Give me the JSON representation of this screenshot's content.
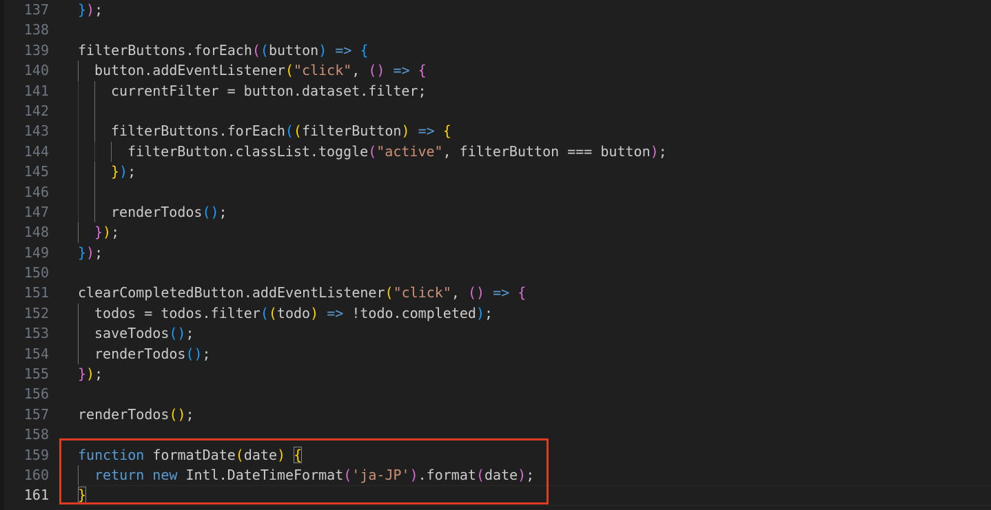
{
  "editor": {
    "language": "javascript",
    "theme": "dark",
    "current_line": 161,
    "lines": [
      {
        "number": 137,
        "indent": 0,
        "tokens": [
          [
            "b3",
            "}"
          ],
          [
            "b2",
            ")"
          ],
          [
            "p",
            ";"
          ]
        ]
      },
      {
        "number": 138,
        "indent": 0,
        "tokens": []
      },
      {
        "number": 139,
        "indent": 0,
        "tokens": [
          [
            "d",
            "filterButtons.forEach"
          ],
          [
            "b2",
            "("
          ],
          [
            "b3",
            "("
          ],
          [
            "d",
            "button"
          ],
          [
            "b3",
            ")"
          ],
          [
            "d",
            " "
          ],
          [
            "k",
            "=>"
          ],
          [
            "d",
            " "
          ],
          [
            "b3",
            "{"
          ]
        ]
      },
      {
        "number": 140,
        "indent": 1,
        "tokens": [
          [
            "d",
            "button.addEventListener"
          ],
          [
            "b1",
            "("
          ],
          [
            "s",
            "\"click\""
          ],
          [
            "p",
            ", "
          ],
          [
            "b2",
            "()"
          ],
          [
            "d",
            " "
          ],
          [
            "k",
            "=>"
          ],
          [
            "d",
            " "
          ],
          [
            "b2",
            "{"
          ]
        ]
      },
      {
        "number": 141,
        "indent": 2,
        "tokens": [
          [
            "d",
            "currentFilter = button.dataset.filter;"
          ]
        ]
      },
      {
        "number": 142,
        "indent": 2,
        "tokens": []
      },
      {
        "number": 143,
        "indent": 2,
        "tokens": [
          [
            "d",
            "filterButtons.forEach"
          ],
          [
            "b3",
            "("
          ],
          [
            "b1",
            "("
          ],
          [
            "d",
            "filterButton"
          ],
          [
            "b1",
            ")"
          ],
          [
            "d",
            " "
          ],
          [
            "k",
            "=>"
          ],
          [
            "d",
            " "
          ],
          [
            "b1",
            "{"
          ]
        ]
      },
      {
        "number": 144,
        "indent": 3,
        "tokens": [
          [
            "d",
            "filterButton.classList.toggle"
          ],
          [
            "b2",
            "("
          ],
          [
            "s",
            "\"active\""
          ],
          [
            "p",
            ", filterButton === button"
          ],
          [
            "b2",
            ")"
          ],
          [
            "p",
            ";"
          ]
        ]
      },
      {
        "number": 145,
        "indent": 2,
        "tokens": [
          [
            "b1",
            "}"
          ],
          [
            "b3",
            ")"
          ],
          [
            "p",
            ";"
          ]
        ]
      },
      {
        "number": 146,
        "indent": 2,
        "tokens": []
      },
      {
        "number": 147,
        "indent": 2,
        "tokens": [
          [
            "d",
            "renderTodos"
          ],
          [
            "b3",
            "()"
          ],
          [
            "p",
            ";"
          ]
        ]
      },
      {
        "number": 148,
        "indent": 1,
        "tokens": [
          [
            "b2",
            "}"
          ],
          [
            "b1",
            ")"
          ],
          [
            "p",
            ";"
          ]
        ]
      },
      {
        "number": 149,
        "indent": 0,
        "tokens": [
          [
            "b3",
            "}"
          ],
          [
            "b2",
            ")"
          ],
          [
            "p",
            ";"
          ]
        ]
      },
      {
        "number": 150,
        "indent": 0,
        "tokens": []
      },
      {
        "number": 151,
        "indent": 0,
        "tokens": [
          [
            "d",
            "clearCompletedButton.addEventListener"
          ],
          [
            "b1",
            "("
          ],
          [
            "s",
            "\"click\""
          ],
          [
            "p",
            ", "
          ],
          [
            "b2",
            "()"
          ],
          [
            "d",
            " "
          ],
          [
            "k",
            "=>"
          ],
          [
            "d",
            " "
          ],
          [
            "b2",
            "{"
          ]
        ]
      },
      {
        "number": 152,
        "indent": 1,
        "tokens": [
          [
            "d",
            "todos = todos.filter"
          ],
          [
            "b3",
            "("
          ],
          [
            "b1",
            "("
          ],
          [
            "d",
            "todo"
          ],
          [
            "b1",
            ")"
          ],
          [
            "d",
            " "
          ],
          [
            "k",
            "=>"
          ],
          [
            "d",
            " !todo.completed"
          ],
          [
            "b3",
            ")"
          ],
          [
            "p",
            ";"
          ]
        ]
      },
      {
        "number": 153,
        "indent": 1,
        "tokens": [
          [
            "d",
            "saveTodos"
          ],
          [
            "b3",
            "()"
          ],
          [
            "p",
            ";"
          ]
        ]
      },
      {
        "number": 154,
        "indent": 1,
        "tokens": [
          [
            "d",
            "renderTodos"
          ],
          [
            "b3",
            "()"
          ],
          [
            "p",
            ";"
          ]
        ]
      },
      {
        "number": 155,
        "indent": 0,
        "tokens": [
          [
            "b2",
            "}"
          ],
          [
            "b1",
            ")"
          ],
          [
            "p",
            ";"
          ]
        ]
      },
      {
        "number": 156,
        "indent": 0,
        "tokens": []
      },
      {
        "number": 157,
        "indent": 0,
        "tokens": [
          [
            "d",
            "renderTodos"
          ],
          [
            "b1",
            "()"
          ],
          [
            "p",
            ";"
          ]
        ]
      },
      {
        "number": 158,
        "indent": 0,
        "tokens": []
      },
      {
        "number": 159,
        "indent": 0,
        "tokens": [
          [
            "k",
            "function"
          ],
          [
            "d",
            " formatDate"
          ],
          [
            "b1",
            "("
          ],
          [
            "d",
            "date"
          ],
          [
            "b1",
            ")"
          ],
          [
            "d",
            " "
          ],
          [
            "b1m",
            "{"
          ]
        ]
      },
      {
        "number": 160,
        "indent": 1,
        "tokens": [
          [
            "k",
            "return"
          ],
          [
            "d",
            " "
          ],
          [
            "k",
            "new"
          ],
          [
            "d",
            " Intl.DateTimeFormat"
          ],
          [
            "b2",
            "("
          ],
          [
            "s",
            "'ja-JP'"
          ],
          [
            "b2",
            ")"
          ],
          [
            "d",
            ".format"
          ],
          [
            "b2",
            "("
          ],
          [
            "d",
            "date"
          ],
          [
            "b2",
            ")"
          ],
          [
            "p",
            ";"
          ]
        ]
      },
      {
        "number": 161,
        "indent": 0,
        "tokens": [
          [
            "b1m",
            "}"
          ]
        ]
      }
    ]
  },
  "colors": {
    "background": "#1f1f1f",
    "highlight_box": "#e03a22",
    "keyword": "#569cd6",
    "string": "#ce9178",
    "bracket_gold": "#ffd700",
    "bracket_orchid": "#da70d6",
    "bracket_blue": "#179fff"
  }
}
